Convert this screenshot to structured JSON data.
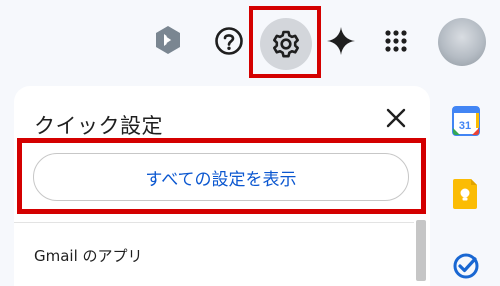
{
  "header": {
    "icons": {
      "extension": "extension-icon",
      "help": "help-icon",
      "settings": "gear-icon",
      "gemini": "gemini-sparkle-icon",
      "apps": "apps-grid-icon",
      "account": "avatar"
    }
  },
  "quick_settings": {
    "title": "クイック設定",
    "all_settings_label": "すべての設定を表示",
    "section_label": "Gmail のアプリ"
  },
  "side_panel": {
    "calendar_date": "31"
  },
  "colors": {
    "highlight": "#d40000",
    "link_blue": "#0b57d0",
    "page_bg": "#f6f8fc"
  }
}
